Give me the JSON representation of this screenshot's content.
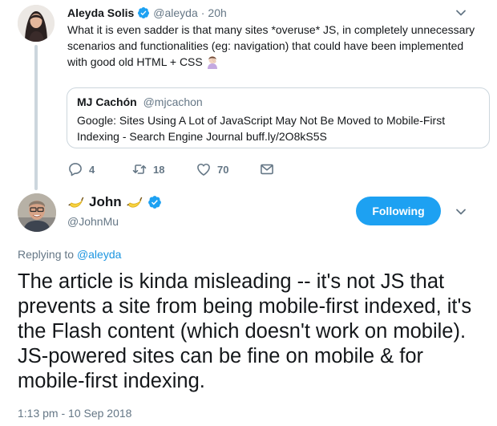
{
  "parent_tweet": {
    "author_name": "Aleyda Solis",
    "handle": "@aleyda",
    "separator": "·",
    "time": "20h",
    "text": "What it is even sadder is that many sites *overuse* JS, in completely unnecessary scenarios and functionalities (eg: navigation) that could have been implemented with good old HTML + CSS",
    "emoji": "person-facepalming-emoji",
    "quoted": {
      "author_name": "MJ Cachón",
      "handle": "@mjcachon",
      "text": "Google: Sites Using A Lot of JavaScript May Not Be Moved to Mobile-First Indexing - Search Engine Journal buff.ly/2O8kS5S"
    },
    "actions": {
      "replies": "4",
      "retweets": "18",
      "likes": "70"
    }
  },
  "main_tweet": {
    "author_name": "John",
    "name_emoji": "banana-emoji",
    "handle": "@JohnMu",
    "follow_label": "Following",
    "replying_prefix": "Replying to",
    "replying_to": "@aleyda",
    "text": "The article is kinda misleading -- it's not JS that prevents a site from being mobile-first indexed, it's the Flash content (which doesn't work on mobile). JS-powered sites can be fine on mobile & for mobile-first indexing.",
    "timestamp": "1:13 pm - 10 Sep 2018"
  },
  "colors": {
    "accent": "#1da1f2",
    "link": "#1b95e0",
    "secondary_text": "#657786",
    "border": "#ccd6dd"
  }
}
